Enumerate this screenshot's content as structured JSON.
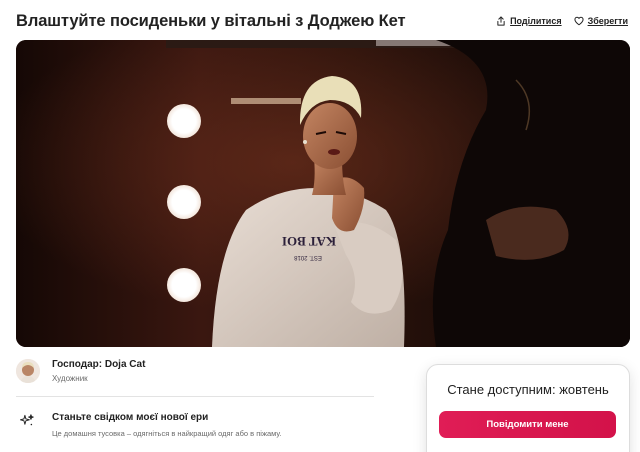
{
  "header": {
    "title": "Влаштуйте посиденьки у вітальні з Доджею Кет",
    "share_label": "Поділитися",
    "save_label": "Зберегти",
    "share_icon": "share-icon",
    "save_icon": "heart-icon"
  },
  "hero": {
    "shirt_text": "KAT BOI",
    "shirt_subtext": "EST. 2018"
  },
  "host": {
    "name": "Господар: Doja Cat",
    "role": "Художник"
  },
  "feature": {
    "icon": "sparkles-icon",
    "title": "Станьте свідком моєї нової ери",
    "subtitle": "Це домашня тусовка – одягніться в найкращий одяг або в піжаму."
  },
  "booking_card": {
    "title": "Стане доступним: жовтень",
    "button_label": "Повідомити мене"
  },
  "colors": {
    "accent": "#E01D56",
    "text": "#222222",
    "muted": "#6A6A6A"
  }
}
